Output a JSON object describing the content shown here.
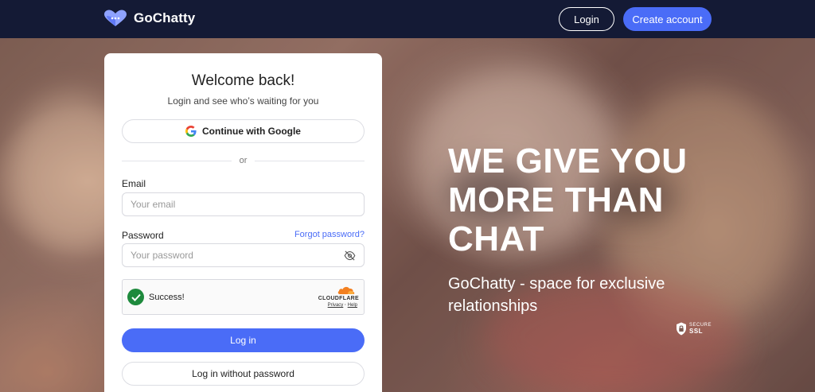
{
  "header": {
    "brand": "GoChatty",
    "login_label": "Login",
    "create_account_label": "Create account"
  },
  "card": {
    "title": "Welcome back!",
    "subtitle": "Login and see who’s waiting for you",
    "google_label": "Continue with Google",
    "divider_text": "or",
    "email_label": "Email",
    "email_placeholder": "Your email",
    "password_label": "Password",
    "forgot_label": "Forgot password?",
    "password_placeholder": "Your password",
    "captcha": {
      "status": "Success!",
      "provider": "CLOUDFLARE",
      "privacy": "Privacy",
      "separator": "·",
      "help": "Help"
    },
    "login_label": "Log in",
    "login_without_password_label": "Log in without password"
  },
  "hero": {
    "headline": "WE GIVE YOU MORE THAN CHAT",
    "tagline": "GoChatty - space for exclusive relationships",
    "ssl_top": "SECURE",
    "ssl_bottom": "SSL"
  },
  "colors": {
    "nav_bg": "#141a35",
    "accent": "#4a6cf7",
    "success": "#1e8a3d"
  },
  "icons": [
    "logo-icon",
    "google-icon",
    "eye-off-icon",
    "check-icon",
    "cloudflare-icon",
    "shield-icon"
  ]
}
